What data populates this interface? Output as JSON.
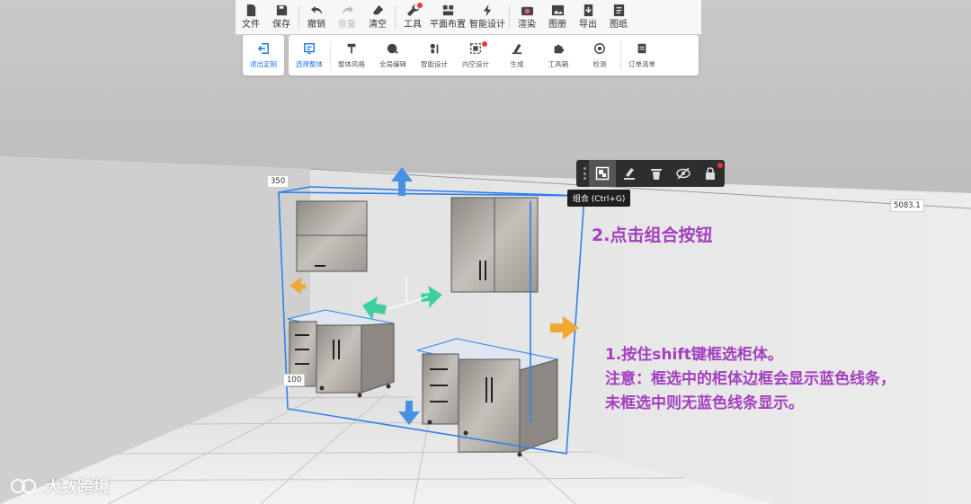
{
  "toolbar": {
    "items": [
      {
        "label": "文件",
        "icon": "file-icon",
        "disabled": false
      },
      {
        "label": "保存",
        "icon": "save-icon",
        "disabled": false
      },
      {
        "label": "撤销",
        "icon": "undo-icon",
        "disabled": false
      },
      {
        "label": "恢复",
        "icon": "redo-icon",
        "disabled": true
      },
      {
        "label": "清空",
        "icon": "eraser-icon",
        "disabled": false
      },
      {
        "label": "工具",
        "icon": "wrench-icon",
        "disabled": false
      },
      {
        "label": "平面布置",
        "icon": "floor-plan-icon",
        "disabled": false
      },
      {
        "label": "智能设计",
        "icon": "lightning-icon",
        "disabled": false
      },
      {
        "label": "渲染",
        "icon": "camera-icon",
        "disabled": false
      },
      {
        "label": "图册",
        "icon": "album-icon",
        "disabled": false
      },
      {
        "label": "导出",
        "icon": "export-icon",
        "disabled": false
      },
      {
        "label": "图纸",
        "icon": "drawing-icon",
        "disabled": false
      }
    ]
  },
  "subtoolbar": {
    "exit": {
      "label": "退出定制",
      "icon": "exit-icon"
    },
    "items": [
      {
        "label": "选择整体",
        "icon": "select-whole-icon",
        "active": true
      },
      {
        "label": "整体风格",
        "icon": "style-brush-icon",
        "active": false
      },
      {
        "label": "全局编辑",
        "icon": "global-edit-icon",
        "active": false
      },
      {
        "label": "智能设计",
        "icon": "smart-design-icon",
        "active": false
      },
      {
        "label": "内空设计",
        "icon": "inner-space-icon",
        "active": false
      },
      {
        "label": "生成",
        "icon": "generate-icon",
        "active": false
      },
      {
        "label": "工具箱",
        "icon": "puzzle-icon",
        "active": false
      },
      {
        "label": "检测",
        "icon": "detect-icon",
        "active": false
      },
      {
        "label": "订单清单",
        "icon": "order-list-icon",
        "active": false
      }
    ]
  },
  "floating_toolbar": {
    "buttons": [
      "group-icon",
      "material-brush-icon",
      "delete-icon",
      "hide-icon",
      "lock-icon"
    ],
    "tooltip": "组合 (Ctrl+G)"
  },
  "dimensions": {
    "top_left": "350",
    "bottom_left": "100",
    "right": "5083.1"
  },
  "annotations": {
    "step2": "2.点击组合按钮",
    "step1_line1": "1.按住shift键框选柜体。",
    "step1_line2": "注意：框选中的柜体边框会显示蓝色线条，",
    "step1_line3": "未框选中则无蓝色线条显示。"
  },
  "watermark": "大数跨境",
  "colors": {
    "selection_blue": "#2f80ed",
    "annotation_purple": "#a43fbf",
    "arrow_orange": "#f0a830",
    "arrow_teal": "#3fcf9f",
    "active_blue": "#1a73e8"
  }
}
